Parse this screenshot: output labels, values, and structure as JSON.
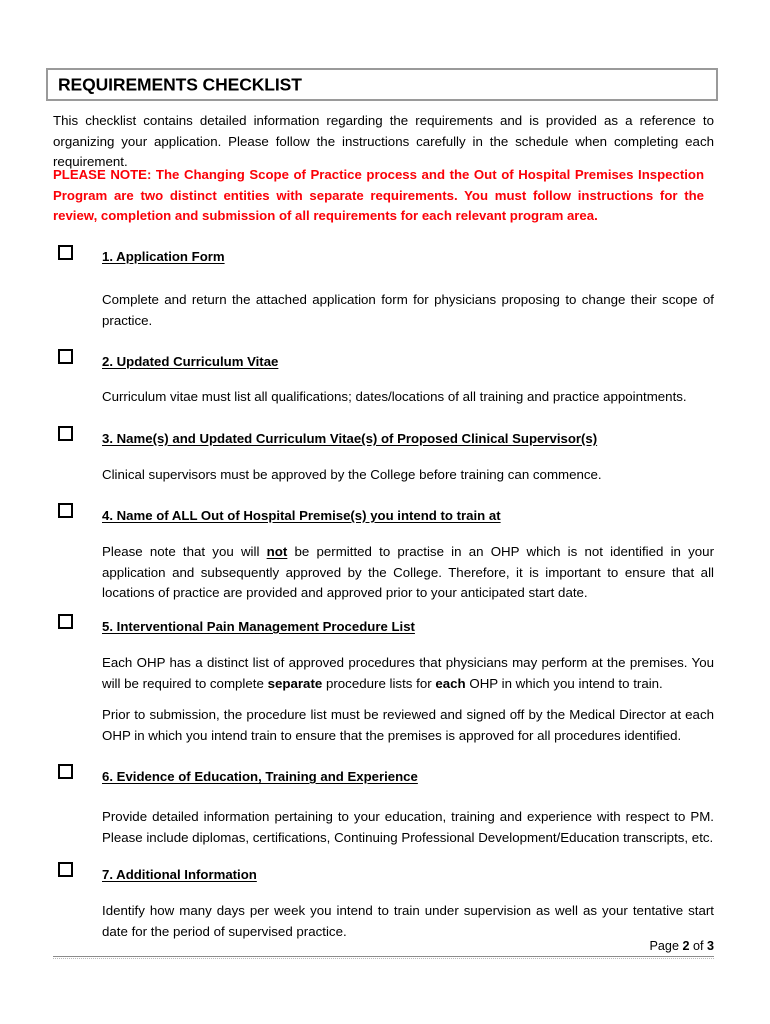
{
  "document": {
    "title": "REQUIREMENTS CHECKLIST",
    "intro": "This checklist contains detailed information regarding the requirements and is provided as a reference to organizing your application. Please follow the instructions carefully in the schedule when completing each requirement.",
    "note": {
      "color": "#fb0007",
      "text": "PLEASE NOTE: The Changing Scope of Practice process and the Out of Hospital Premises Inspection Program are two distinct entities with separate requirements. You must follow instructions for the review, completion and submission of all requirements for each relevant program area."
    },
    "items": [
      {
        "number": "1.",
        "heading": "1.  Application Form",
        "checkbox_state": "unchecked",
        "paragraphs": [
          {
            "segments": [
              {
                "text": "Complete and return the attached application form for physicians proposing to change their scope of practice.",
                "style": "normal"
              }
            ]
          }
        ]
      },
      {
        "number": "2.",
        "heading": "2.  Updated Curriculum Vitae",
        "checkbox_state": "unchecked",
        "paragraphs": [
          {
            "segments": [
              {
                "text": "Curriculum vitae must list all qualifications; dates/locations of all training and practice appointments.",
                "style": "normal"
              }
            ]
          }
        ]
      },
      {
        "number": "3.",
        "heading": "3.  Name(s) and Updated Curriculum Vitae(s) of Proposed Clinical Supervisor(s)",
        "checkbox_state": "unchecked",
        "paragraphs": [
          {
            "segments": [
              {
                "text": "Clinical supervisors must be approved by the College before training can commence.",
                "style": "normal"
              }
            ]
          }
        ]
      },
      {
        "number": "4.",
        "heading": "4.  Name of ALL Out of Hospital Premise(s) you intend to train at",
        "checkbox_state": "unchecked",
        "paragraphs": [
          {
            "segments": [
              {
                "text": "Please note that you will ",
                "style": "normal"
              },
              {
                "text": "not",
                "style": "bold-underline"
              },
              {
                "text": " be permitted to practise in an OHP which is not identified in your application and subsequently approved by the College. Therefore, it is important to ensure that all locations of practice are provided and approved prior to your anticipated start date.",
                "style": "normal"
              }
            ]
          }
        ]
      },
      {
        "number": "5.",
        "heading": "5.  Interventional Pain Management Procedure List",
        "checkbox_state": "unchecked",
        "paragraphs": [
          {
            "segments": [
              {
                "text": "Each OHP has a distinct list of approved procedures that physicians may perform at the premises. You will be required to complete ",
                "style": "normal"
              },
              {
                "text": "separate",
                "style": "bold"
              },
              {
                "text": " procedure lists for ",
                "style": "normal"
              },
              {
                "text": "each",
                "style": "bold"
              },
              {
                "text": " OHP in which you intend to train.",
                "style": "normal"
              }
            ]
          },
          {
            "segments": [
              {
                "text": "Prior to submission, the procedure list must be reviewed and signed off by the Medical Director at each OHP in which you intend train to ensure that the premises is approved for all procedures identified.",
                "style": "normal"
              }
            ]
          }
        ]
      },
      {
        "number": "6.",
        "heading": "6.  Evidence of Education, Training and Experience",
        "checkbox_state": "unchecked",
        "paragraphs": [
          {
            "segments": [
              {
                "text": "Provide detailed information pertaining to your education, training and experience with respect to PM. Please include diplomas, certifications, Continuing Professional Development/Education transcripts, etc.",
                "style": "normal"
              }
            ]
          }
        ]
      },
      {
        "number": "7.",
        "heading": "7.  Additional Information",
        "checkbox_state": "unchecked",
        "paragraphs": [
          {
            "segments": [
              {
                "text": "Identify how many days per week you intend to train under supervision as well as your tentative start date for the period of supervised practice.",
                "style": "normal"
              }
            ]
          }
        ]
      }
    ],
    "footer": {
      "page_label": "Page",
      "page_number": "2",
      "of_label": "of",
      "total_pages": "3"
    }
  }
}
